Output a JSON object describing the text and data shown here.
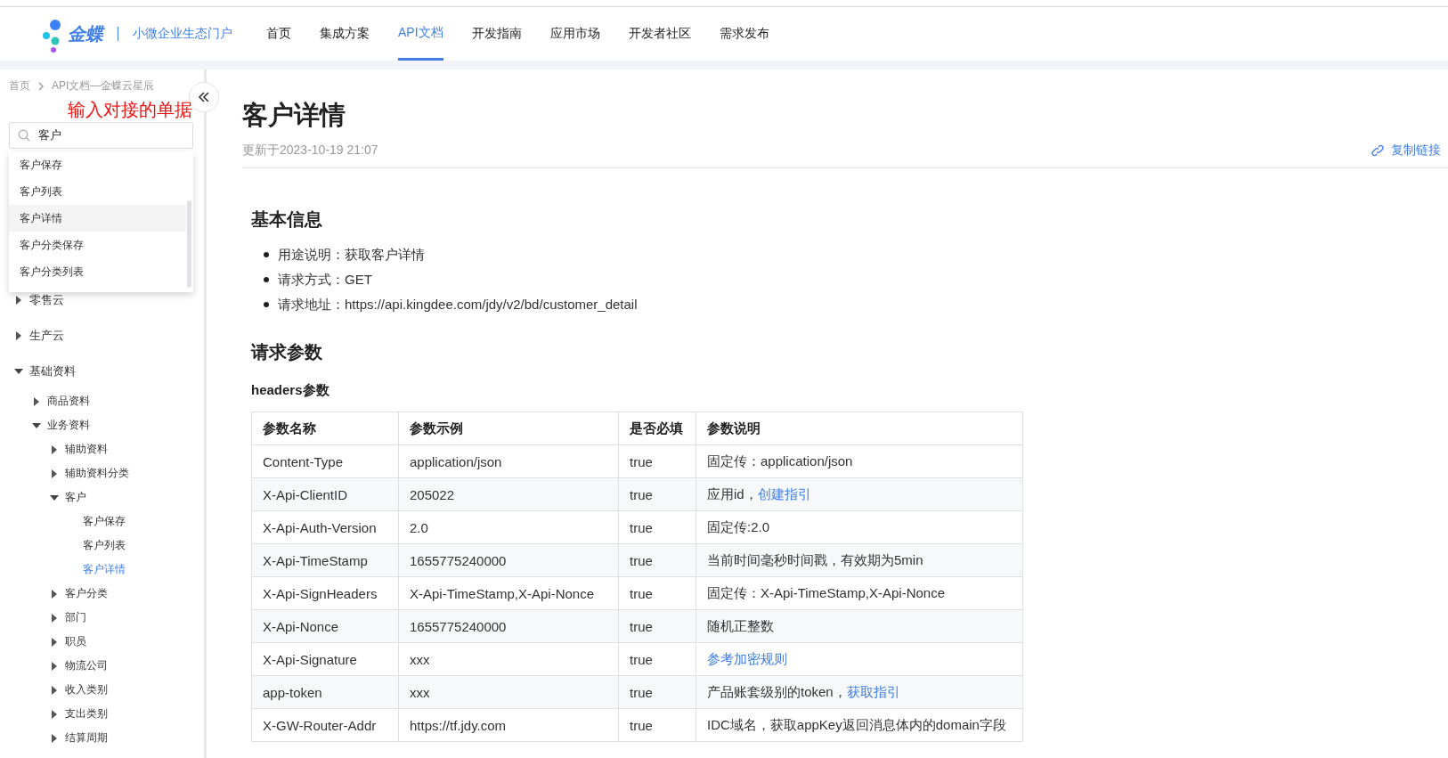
{
  "header": {
    "brand": "金蝶",
    "subtitle": "小微企业生态门户",
    "nav": [
      {
        "label": "首页",
        "selected": false
      },
      {
        "label": "集成方案",
        "selected": false
      },
      {
        "label": "API文档",
        "selected": true
      },
      {
        "label": "开发指南",
        "selected": false
      },
      {
        "label": "应用市场",
        "selected": false
      },
      {
        "label": "开发者社区",
        "selected": false
      },
      {
        "label": "需求发布",
        "selected": false
      }
    ]
  },
  "sidebar": {
    "breadcrumb": [
      "首页",
      "API文档—金蝶云星辰"
    ],
    "search": {
      "value": "客户"
    },
    "annotation": "输入对接的单据",
    "suggestions": [
      {
        "label": "客户保存",
        "selected": false
      },
      {
        "label": "客户列表",
        "selected": false
      },
      {
        "label": "客户详情",
        "selected": true
      },
      {
        "label": "客户分类保存",
        "selected": false
      },
      {
        "label": "客户分类列表",
        "selected": false
      }
    ],
    "tree": [
      {
        "label": "零售云",
        "expanded": false,
        "selected": false
      },
      {
        "label": "生产云",
        "expanded": false,
        "selected": false
      },
      {
        "label": "基础资料",
        "expanded": true,
        "selected": false,
        "children": [
          {
            "label": "商品资料",
            "expanded": false,
            "selected": false
          },
          {
            "label": "业务资料",
            "expanded": true,
            "selected": false,
            "children": [
              {
                "label": "辅助资料",
                "expanded": false,
                "selected": false
              },
              {
                "label": "辅助资料分类",
                "expanded": false,
                "selected": false
              },
              {
                "label": "客户",
                "expanded": true,
                "selected": false,
                "children": [
                  {
                    "label": "客户保存",
                    "selected": false
                  },
                  {
                    "label": "客户列表",
                    "selected": false
                  },
                  {
                    "label": "客户详情",
                    "selected": true
                  }
                ]
              },
              {
                "label": "客户分类",
                "expanded": false,
                "selected": false
              },
              {
                "label": "部门",
                "expanded": false,
                "selected": false
              },
              {
                "label": "职员",
                "expanded": false,
                "selected": false
              },
              {
                "label": "物流公司",
                "expanded": false,
                "selected": false
              },
              {
                "label": "收入类别",
                "expanded": false,
                "selected": false
              },
              {
                "label": "支出类别",
                "expanded": false,
                "selected": false
              },
              {
                "label": "结算周期",
                "expanded": false,
                "selected": false
              }
            ]
          }
        ]
      }
    ]
  },
  "main": {
    "title": "客户详情",
    "updated": "更新于2023-10-19 21:07",
    "copy_link": "复制链接",
    "basic_heading": "基本信息",
    "basic_items": [
      "用途说明：获取客户详情",
      "请求方式：GET",
      "请求地址：https://api.kingdee.com/jdy/v2/bd/customer_detail"
    ],
    "params_heading": "请求参数",
    "headers_heading": "headers参数",
    "table": {
      "columns": [
        "参数名称",
        "参数示例",
        "是否必填",
        "参数说明"
      ],
      "rows": [
        {
          "name": "Content-Type",
          "example": "application/json",
          "required": "true",
          "description": [
            {
              "kind": "text",
              "text": "固定传：application/json"
            }
          ]
        },
        {
          "name": "X-Api-ClientID",
          "example": "205022",
          "required": "true",
          "description": [
            {
              "kind": "text",
              "text": "应用id，"
            },
            {
              "kind": "link",
              "text": "创建指引"
            }
          ]
        },
        {
          "name": "X-Api-Auth-Version",
          "example": "2.0",
          "required": "true",
          "description": [
            {
              "kind": "text",
              "text": "固定传:2.0"
            }
          ]
        },
        {
          "name": "X-Api-TimeStamp",
          "example": "1655775240000",
          "required": "true",
          "description": [
            {
              "kind": "text",
              "text": "当前时间毫秒时间戳，有效期为5min"
            }
          ]
        },
        {
          "name": "X-Api-SignHeaders",
          "example": "X-Api-TimeStamp,X-Api-Nonce",
          "required": "true",
          "description": [
            {
              "kind": "text",
              "text": "固定传：X-Api-TimeStamp,X-Api-Nonce"
            }
          ]
        },
        {
          "name": "X-Api-Nonce",
          "example": "1655775240000",
          "required": "true",
          "description": [
            {
              "kind": "text",
              "text": "随机正整数"
            }
          ]
        },
        {
          "name": "X-Api-Signature",
          "example": "xxx",
          "required": "true",
          "description": [
            {
              "kind": "link",
              "text": "参考加密规则"
            }
          ]
        },
        {
          "name": "app-token",
          "example": "xxx",
          "required": "true",
          "description": [
            {
              "kind": "text",
              "text": "产品账套级别的token，"
            },
            {
              "kind": "link",
              "text": "获取指引"
            }
          ]
        },
        {
          "name": "X-GW-Router-Addr",
          "example": "https://tf.jdy.com",
          "required": "true",
          "description": [
            {
              "kind": "text",
              "text": "IDC域名，获取appKey返回消息体内的domain字段"
            }
          ]
        }
      ]
    }
  }
}
